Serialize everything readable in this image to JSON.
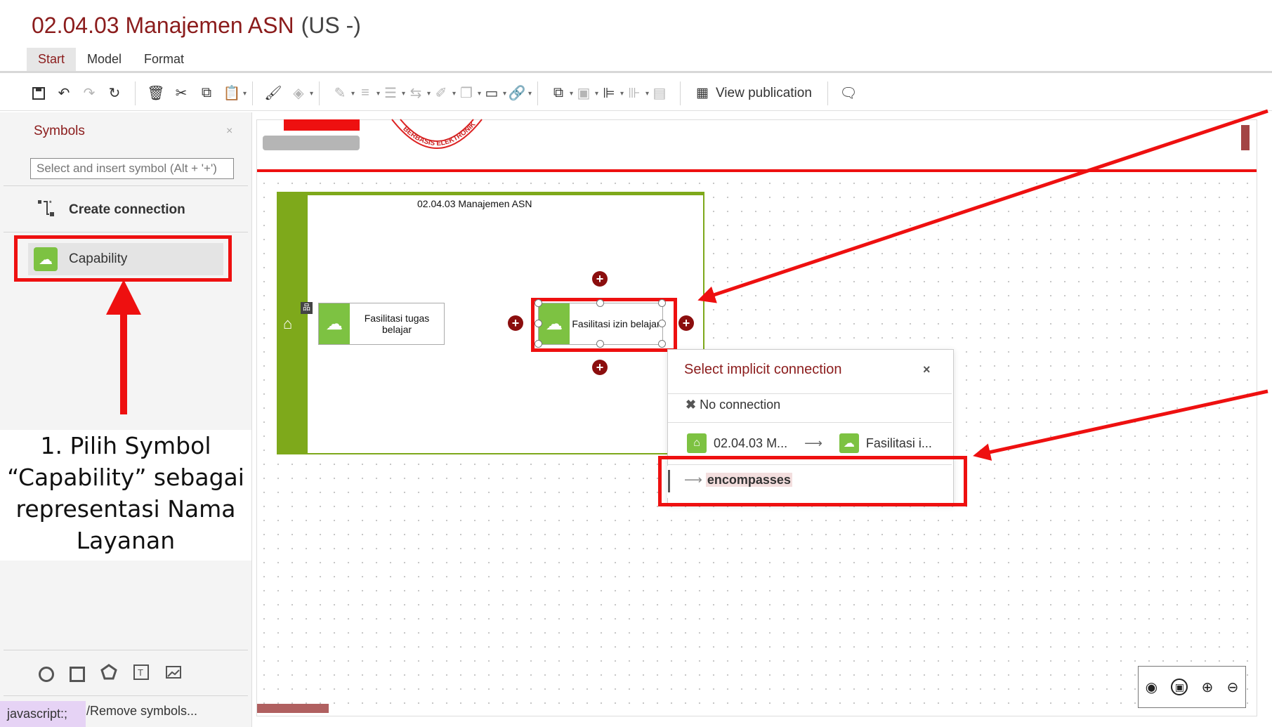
{
  "header": {
    "title": "02.04.03 Manajemen ASN",
    "language": "(US -)",
    "tabs": [
      "Start",
      "Model",
      "Format"
    ]
  },
  "toolbar": {
    "view_publication": "View publication"
  },
  "sidebar": {
    "title": "Symbols",
    "search_placeholder": "Select and insert symbol (Alt + '+')",
    "create_connection": "Create connection",
    "capability": "Capability",
    "remove_symbols": "/Remove symbols...",
    "js_tooltip": "javascript:;"
  },
  "annotation": {
    "line1": "1. Pilih Symbol",
    "line2": "“Capability” sebagai",
    "line3": "representasi Nama",
    "line4": "Layanan"
  },
  "diagram": {
    "lane_title": "02.04.03 Manajemen ASN",
    "node1_line1": "Fasilitasi tugas",
    "node1_line2": "belajar",
    "node2": "Fasilitasi izin belajar"
  },
  "seal_text": "BERBASIS ELEKTRONIK",
  "popup": {
    "title": "Select implicit connection",
    "close": "×",
    "no_connection": "No connection",
    "from": "02.04.03 M...",
    "to": "Fasilitasi i...",
    "encompasses": "encompasses"
  },
  "colors": {
    "accent": "#8b1c1c",
    "highlight": "#ee1010",
    "lane": "#7ea91b",
    "capability": "#7dc242"
  }
}
